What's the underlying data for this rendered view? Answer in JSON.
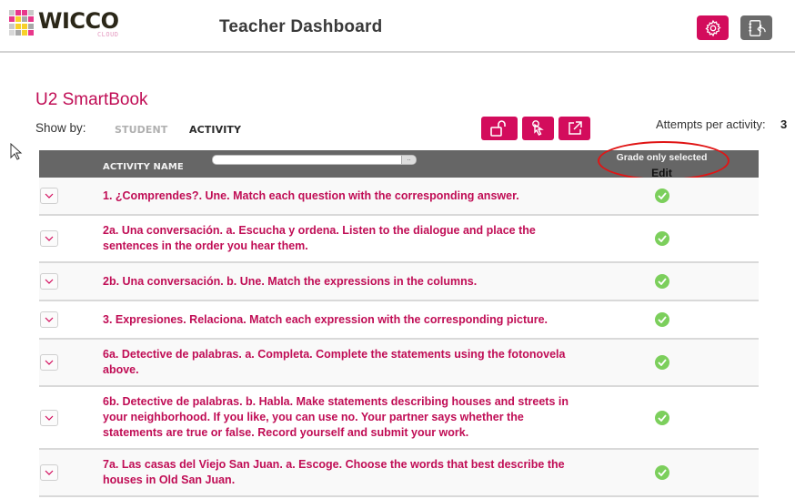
{
  "header": {
    "logo_word": "WICCO",
    "logo_sub": "CLOUD",
    "title": "Teacher Dashboard",
    "settings_icon": "gear-icon",
    "notebook_icon": "notebook-return-icon"
  },
  "page": {
    "title": "U2 SmartBook",
    "show_by_label": "Show by:",
    "tabs": [
      {
        "label": "STUDENT",
        "active": false
      },
      {
        "label": "ACTIVITY",
        "active": true
      }
    ],
    "actions": [
      {
        "name": "unlock",
        "icon": "unlock-icon"
      },
      {
        "name": "select",
        "icon": "pointer-hand-icon"
      },
      {
        "name": "open",
        "icon": "external-link-icon"
      }
    ],
    "attempts_label": "Attempts per activity:",
    "attempts_value": "3"
  },
  "table": {
    "column_name": "ACTIVITY NAME",
    "filter_value": "",
    "filter_button": "..",
    "grade_label": "Grade only selected",
    "edit_label": "Edit",
    "colors": {
      "accent": "#d30c5c",
      "header_bg": "#666666",
      "check": "#7ccf5c"
    },
    "rows": [
      {
        "text": "1. ¿Comprendes?. Une. Match each question with the corresponding answer.",
        "status": "complete"
      },
      {
        "text": "2a. Una conversación. a. Escucha y ordena. Listen to the dialogue and place the sentences in the order you hear them.",
        "status": "complete"
      },
      {
        "text": "2b. Una conversación. b. Une. Match the expressions in the columns.",
        "status": "complete"
      },
      {
        "text": "3. Expresiones. Relaciona. Match each expression with the corresponding picture.",
        "status": "complete"
      },
      {
        "text": "6a. Detective de palabras. a. Completa. Complete the statements using the fotonovela above.",
        "status": "complete"
      },
      {
        "text": "6b. Detective de palabras. b. Habla. Make statements describing houses and streets in your neighborhood. If you like, you can use no. Your partner says whether the statements are true or false. Record yourself and submit your work.",
        "status": "complete"
      },
      {
        "text": "7a. Las casas del Viejo San Juan. a. Escoge. Choose the words that best describe the houses in Old San Juan.",
        "status": "complete"
      }
    ]
  }
}
